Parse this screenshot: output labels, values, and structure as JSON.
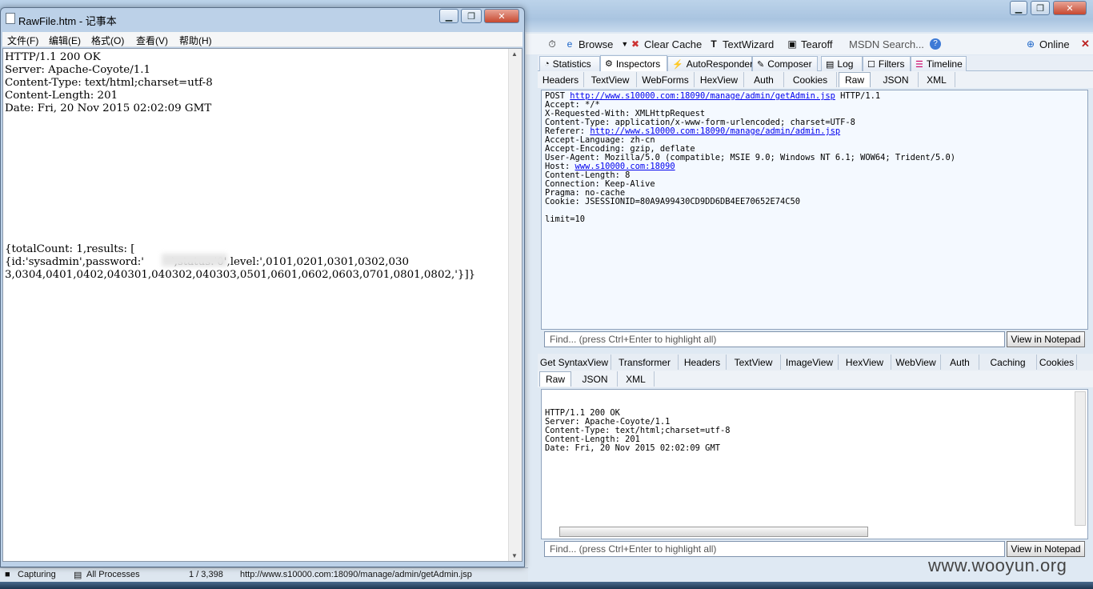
{
  "notepad": {
    "title": "RawFile.htm - 记事本",
    "menu": [
      "文件(F)",
      "编辑(E)",
      "格式(O)",
      "查看(V)",
      "帮助(H)"
    ],
    "content": "HTTP/1.1 200 OK\nServer: Apache-Coyote/1.1\nContent-Type: text/html;charset=utf-8\nContent-Length: 201\nDate: Fri, 20 Nov 2015 02:02:09 GMT\n\n\n\n\n\n\n\n\n\n\n{totalCount: 1,results: [\n{id:'sysadmin',password:'        ',status:'0',level:',0101,0201,0301,0302,030\n3,0304,0401,0402,040301,040302,040303,0501,0601,0602,0603,0701,0801,0802,'}]}"
  },
  "toolbar": {
    "browse": "Browse",
    "clear_cache": "Clear Cache",
    "textwizard": "TextWizard",
    "tearoff": "Tearoff",
    "msdn_search": "MSDN Search...",
    "online": "Online"
  },
  "main_tabs": [
    "Statistics",
    "Inspectors",
    "AutoResponder",
    "Composer",
    "Log",
    "Filters",
    "Timeline"
  ],
  "request": {
    "tabs": [
      "Headers",
      "TextView",
      "WebForms",
      "HexView",
      "Auth",
      "Cookies",
      "Raw",
      "JSON",
      "XML"
    ],
    "selected_tab": "Raw",
    "method": "POST",
    "url": "http://www.s10000.com:18090/manage/admin/getAdmin.jsp",
    "protocol": "HTTP/1.1",
    "headers_1": "Accept: */*\nX-Requested-With: XMLHttpRequest\nContent-Type: application/x-www-form-urlencoded; charset=UTF-8",
    "referer_label": "Referer:",
    "referer_url": "http://www.s10000.com:18090/manage/admin/admin.jsp",
    "headers_2": "Accept-Language: zh-cn\nAccept-Encoding: gzip, deflate\nUser-Agent: Mozilla/5.0 (compatible; MSIE 9.0; Windows NT 6.1; WOW64; Trident/5.0)",
    "host_label": "Host:",
    "host_url": "www.s10000.com:18090",
    "headers_3": "Content-Length: 8\nConnection: Keep-Alive\nPragma: no-cache\nCookie: JSESSIONID=80A9A99430CD9DD6DB4EE70652E74C50\n\nlimit=10",
    "find_placeholder": "Find... (press Ctrl+Enter to highlight all)",
    "view_button": "View in Notepad"
  },
  "response": {
    "tabs_row1": [
      "Get SyntaxView",
      "Transformer",
      "Headers",
      "TextView",
      "ImageView",
      "HexView",
      "WebView",
      "Auth",
      "Caching",
      "Cookies"
    ],
    "tabs_row2": [
      "Raw",
      "JSON",
      "XML"
    ],
    "content": "HTTP/1.1 200 OK\nServer: Apache-Coyote/1.1\nContent-Type: text/html;charset=utf-8\nContent-Length: 201\nDate: Fri, 20 Nov 2015 02:02:09 GMT",
    "find_placeholder": "Find... (press Ctrl+Enter to highlight all)",
    "view_button": "View in Notepad"
  },
  "statusbar": {
    "capturing": "Capturing",
    "processes": "All Processes",
    "count": "1 / 3,398",
    "url": "http://www.s10000.com:18090/manage/admin/getAdmin.jsp"
  },
  "watermark": "www.wooyun.org"
}
